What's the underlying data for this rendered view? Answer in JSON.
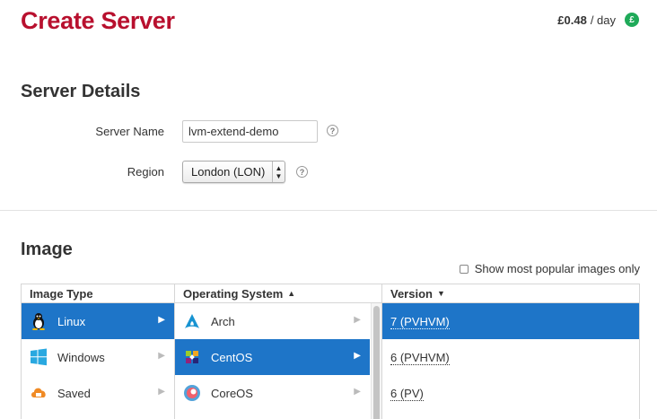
{
  "header": {
    "title": "Create Server",
    "cost_amount": "£0.48",
    "cost_period": "/ day",
    "currency_badge": "£"
  },
  "server_details": {
    "heading": "Server Details",
    "name_label": "Server Name",
    "name_value": "lvm-extend-demo",
    "region_label": "Region",
    "region_value": "London (LON)",
    "help": "?"
  },
  "image": {
    "heading": "Image",
    "popular_label": "Show most popular images only",
    "columns": {
      "type": "Image Type",
      "os": "Operating System",
      "version": "Version"
    },
    "types": [
      {
        "label": "Linux",
        "icon": "tux-icon",
        "selected": true
      },
      {
        "label": "Windows",
        "icon": "windows-icon",
        "selected": false
      },
      {
        "label": "Saved",
        "icon": "saved-image-icon",
        "selected": false
      }
    ],
    "os": [
      {
        "label": "Arch",
        "icon": "arch-icon",
        "selected": false
      },
      {
        "label": "CentOS",
        "icon": "centos-icon",
        "selected": true
      },
      {
        "label": "CoreOS",
        "icon": "coreos-icon",
        "selected": false
      }
    ],
    "versions": [
      {
        "label": "7 (PVHVM)",
        "selected": true
      },
      {
        "label": "6 (PVHVM)",
        "selected": false
      },
      {
        "label": "6 (PV)",
        "selected": false
      }
    ]
  },
  "colors": {
    "title": "#b8102e",
    "selection": "#1e75c8",
    "badge": "#1faa59"
  }
}
